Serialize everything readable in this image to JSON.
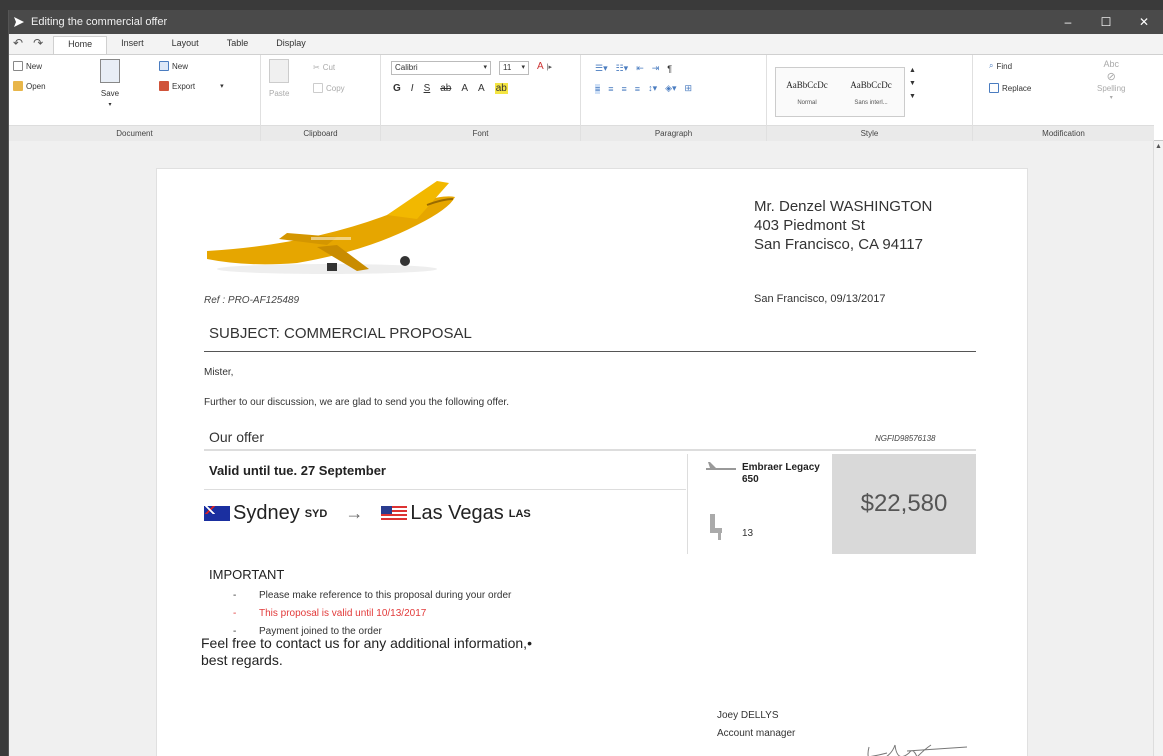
{
  "window": {
    "title": "Editing the commercial offer",
    "controls": [
      "–",
      "☐",
      "✕"
    ]
  },
  "quick_access": {
    "undo": "↶",
    "redo": "↷"
  },
  "tabs": [
    {
      "label": "Home",
      "active": true
    },
    {
      "label": "Insert"
    },
    {
      "label": "Layout"
    },
    {
      "label": "Table"
    },
    {
      "label": "Display"
    }
  ],
  "ribbon": {
    "document": {
      "label": "Document",
      "new": "New",
      "open": "Open",
      "save": "Save",
      "new2": "New",
      "export": "Export"
    },
    "clipboard": {
      "label": "Clipboard",
      "paste": "Paste",
      "cut": "Cut",
      "copy": "Copy"
    },
    "font": {
      "label": "Font",
      "family": "Calibri",
      "size": "11",
      "bold": "G",
      "italic": "I",
      "underline": "S",
      "strike": "ab",
      "subscript": "A",
      "superscript": "A",
      "highlight": "ab"
    },
    "paragraph": {
      "label": "Paragraph",
      "pilcrow": "¶"
    },
    "style": {
      "label": "Style",
      "sample1": "AaBbCcDc",
      "name1": "Normal",
      "sample2": "AaBbCcDc",
      "name2": "Sans interl..."
    },
    "modification": {
      "label": "Modification",
      "find": "Find",
      "replace": "Replace",
      "spelling": "Spelling",
      "abc": "Abc"
    }
  },
  "letter": {
    "recipient": {
      "name": "Mr. Denzel WASHINGTON",
      "street": "403 Piedmont St",
      "city": "San Francisco, CA 94117"
    },
    "ref": "Ref : PRO-AF125489",
    "date": "San Francisco, 09/13/2017",
    "subject": "SUBJECT: COMMERCIAL PROPOSAL",
    "salutation": "Mister,",
    "intro": "Further to our discussion, we are glad to send you the following offer.",
    "offer_heading": "Our offer",
    "offer_code": "NGFID98576138",
    "validity": "Valid until tue. 27 September",
    "route": {
      "from_city": "Sydney",
      "from_code": "SYD",
      "arrow": "→",
      "to_city": "Las Vegas",
      "to_code": "LAS"
    },
    "aircraft": "Embraer Legacy 650",
    "seats": "13",
    "price": "$22,580",
    "important_title": "IMPORTANT",
    "important_items": [
      {
        "text": "Please make reference to this proposal during your order",
        "color": "#333333"
      },
      {
        "text": "This proposal is valid until 10/13/2017",
        "color": "#e23a3a"
      },
      {
        "text": "Payment joined to the order",
        "color": "#333333"
      }
    ],
    "closing_line1": "Feel free to contact us for any additional information,•",
    "closing_line2": "best regards.",
    "signer_name": "Joey DELLYS",
    "signer_title": "Account manager"
  }
}
